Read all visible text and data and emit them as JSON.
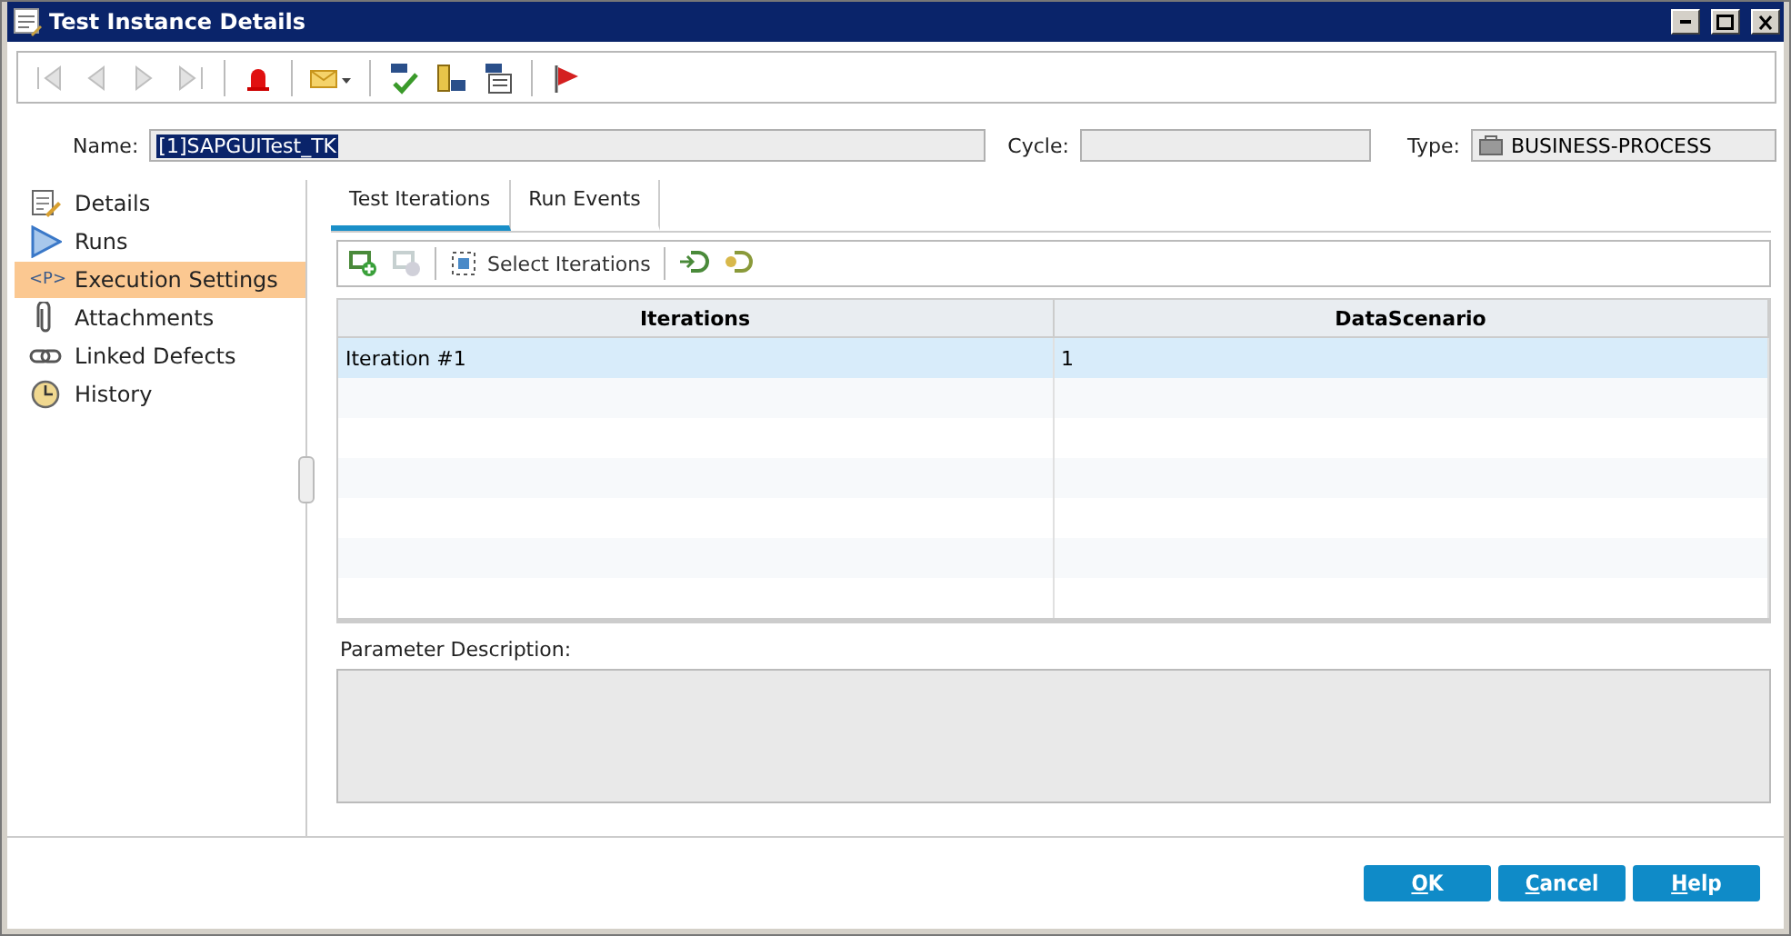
{
  "window": {
    "title": "Test Instance Details",
    "controls": [
      {
        "kind": "minimize"
      },
      {
        "kind": "maximize"
      },
      {
        "kind": "close"
      }
    ]
  },
  "toolbar": [
    {
      "kind": "first",
      "disabled": true
    },
    {
      "kind": "prev",
      "disabled": true
    },
    {
      "kind": "next",
      "disabled": true
    },
    {
      "kind": "last",
      "disabled": true
    },
    {
      "kind": "sep"
    },
    {
      "kind": "alert",
      "disabled": false
    },
    {
      "kind": "sep"
    },
    {
      "kind": "mail",
      "disabled": false
    },
    {
      "kind": "sep"
    },
    {
      "kind": "spell",
      "disabled": false
    },
    {
      "kind": "thesaurus",
      "disabled": false
    },
    {
      "kind": "spellopts",
      "disabled": false
    },
    {
      "kind": "sep"
    },
    {
      "kind": "flag",
      "disabled": false
    }
  ],
  "fields": {
    "name": {
      "label": "Name:",
      "value": "[1]SAPGUITest_TK"
    },
    "cycle": {
      "label": "Cycle:"
    },
    "type": {
      "label": "Type:",
      "value": "BUSINESS-PROCESS"
    }
  },
  "sidebar": {
    "items": [
      {
        "kind": "details",
        "label": "Details",
        "selected": false
      },
      {
        "kind": "runs",
        "label": "Runs",
        "selected": false
      },
      {
        "kind": "params",
        "label": "Execution Settings",
        "glyph": "<P>",
        "selected": true
      },
      {
        "kind": "attach",
        "label": "Attachments",
        "selected": false
      },
      {
        "kind": "link",
        "label": "Linked Defects",
        "selected": false
      },
      {
        "kind": "history",
        "label": "History",
        "selected": false
      }
    ]
  },
  "tabs": [
    {
      "label": "Test Iterations",
      "selected": true
    },
    {
      "label": "Run Events",
      "selected": false
    }
  ],
  "grid_toolbar": [
    {
      "kind": "add",
      "disabled": false
    },
    {
      "kind": "remove",
      "disabled": true
    },
    {
      "kind": "sep"
    },
    {
      "kind": "select",
      "label": "Select Iterations",
      "disabled": false
    },
    {
      "kind": "sep"
    },
    {
      "kind": "import",
      "disabled": false
    },
    {
      "kind": "export",
      "disabled": false
    }
  ],
  "table": {
    "columns": [
      "Iterations",
      "DataScenario"
    ],
    "rows": [
      {
        "cells": [
          "Iteration #1",
          "1"
        ],
        "selected": true
      }
    ]
  },
  "parameter_description": {
    "label": "Parameter Description:"
  },
  "buttons": [
    {
      "label": "OK"
    },
    {
      "label": "Cancel"
    },
    {
      "label": "Help"
    }
  ]
}
